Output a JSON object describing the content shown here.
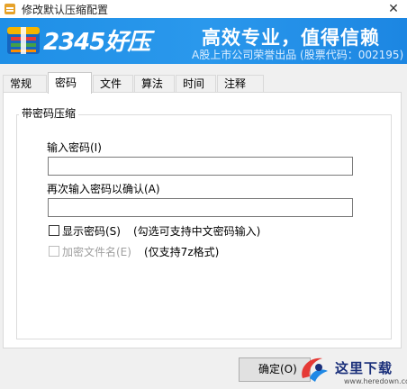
{
  "window": {
    "title": "修改默认压缩配置",
    "close_glyph": "✕"
  },
  "banner": {
    "brand": "2345好压",
    "slogan": "高效专业，值得信赖",
    "subtitle": "A股上市公司荣誉出品 (股票代码：002195)",
    "colors": {
      "background": "#1f8fe6",
      "text": "#ffffff"
    }
  },
  "tabs": [
    {
      "label": "常规",
      "active": false
    },
    {
      "label": "密码",
      "active": true
    },
    {
      "label": "文件",
      "active": false
    },
    {
      "label": "算法",
      "active": false
    },
    {
      "label": "时间",
      "active": false
    },
    {
      "label": "注释",
      "active": false
    }
  ],
  "password_group": {
    "title": "带密码压缩",
    "password_label": "输入密码(I)",
    "password_value": "",
    "confirm_label": "再次输入密码以确认(A)",
    "confirm_value": "",
    "show_password": {
      "label": "显示密码(S)",
      "checked": false,
      "enabled": true,
      "note": "(勾选可支持中文密码输入)"
    },
    "encrypt_names": {
      "label": "加密文件名(E)",
      "checked": false,
      "enabled": false,
      "note": "(仅支持7z格式)"
    }
  },
  "buttons": {
    "ok": "确定(O)"
  },
  "watermark": {
    "text": "这里下载",
    "url": "www.heredown.com"
  }
}
